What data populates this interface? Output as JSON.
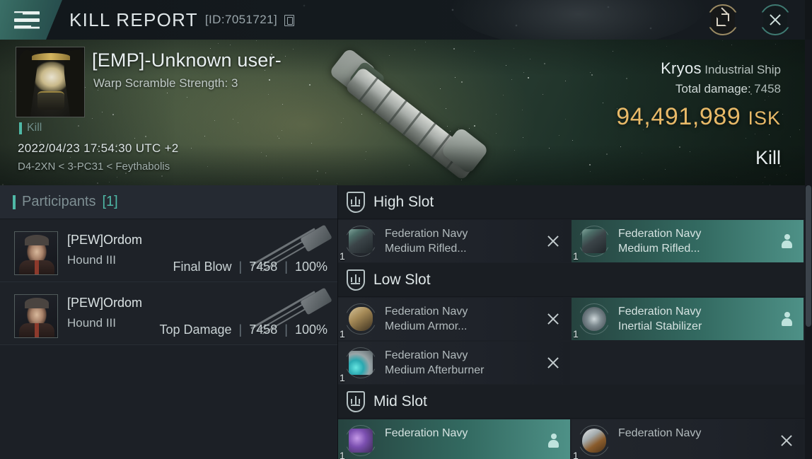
{
  "titlebar": {
    "menu_icon": "hamburger-menu-icon",
    "title": "KILL REPORT",
    "id_label": "[ID:7051721]",
    "copy_icon": "copy-icon",
    "external_icon": "external-link-icon",
    "close_icon": "close-icon"
  },
  "banner": {
    "victim_name": "[EMP]-Unknown user-",
    "victim_subtitle": "Warp Scramble Strength: 3",
    "kill_tag": "Kill",
    "timestamp": "2022/04/23 17:54:30 UTC +2",
    "location": "D4-2XN < 3-PC31 < Feythabolis",
    "ship_name": "Kryos",
    "ship_class": "Industrial Ship",
    "damage_label": "Total damage:",
    "damage_value": "7458",
    "isk_value": "94,491,989",
    "isk_unit": "ISK",
    "result": "Kill",
    "accent_isk": "#e8b968",
    "accent_teal": "#4fb8a6"
  },
  "participants": {
    "header_label": "Participants",
    "header_count": "[1]",
    "rows": [
      {
        "name": "[PEW]Ordom",
        "ship": "Hound III",
        "role": "Final Blow",
        "damage": "7458",
        "percent": "100%"
      },
      {
        "name": "[PEW]Ordom",
        "ship": "Hound III",
        "role": "Top Damage",
        "damage": "7458",
        "percent": "100%"
      }
    ]
  },
  "fitting": {
    "sections": [
      {
        "title": "High Slot",
        "icon": "slot-shield-icon",
        "rows": [
          {
            "left": {
              "state": "destroyed",
              "qty": "1",
              "line1": "Federation Navy",
              "line2": "Medium Rifled...",
              "mark": "x-icon",
              "art": "turret"
            },
            "right": {
              "state": "dropped",
              "qty": "1",
              "line1": "Federation Navy",
              "line2": "Medium Rifled...",
              "mark": "person-icon",
              "art": "turret"
            }
          }
        ]
      },
      {
        "title": "Low Slot",
        "icon": "slot-shield-icon",
        "rows": [
          {
            "left": {
              "state": "destroyed",
              "qty": "1",
              "line1": "Federation Navy",
              "line2": "Medium Armor...",
              "mark": "x-icon",
              "art": "armor"
            },
            "right": {
              "state": "dropped",
              "qty": "1",
              "line1": "Federation Navy",
              "line2": "Inertial Stabilizer",
              "mark": "person-icon",
              "art": "inert"
            }
          },
          {
            "left": {
              "state": "destroyed",
              "qty": "1",
              "line1": "Federation Navy",
              "line2": "Medium Afterburner",
              "mark": "x-icon",
              "art": "ab"
            },
            "right": {
              "state": "empty",
              "qty": "",
              "line1": "",
              "line2": "",
              "mark": "",
              "art": ""
            }
          }
        ]
      },
      {
        "title": "Mid Slot",
        "icon": "slot-shield-icon",
        "rows": [
          {
            "left": {
              "state": "dropped",
              "qty": "1",
              "line1": "Federation Navy",
              "line2": "",
              "mark": "person-icon",
              "art": "web"
            },
            "right": {
              "state": "destroyed",
              "qty": "1",
              "line1": "Federation Navy",
              "line2": "",
              "mark": "x-icon",
              "art": "shield"
            }
          }
        ]
      }
    ]
  }
}
